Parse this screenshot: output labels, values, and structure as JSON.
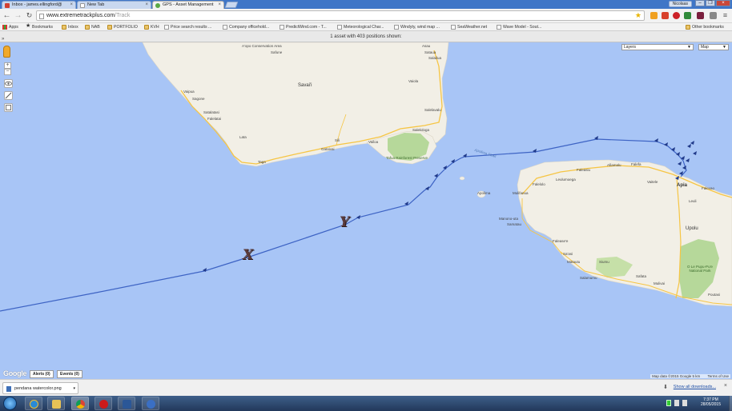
{
  "tabs": [
    {
      "label": "Inbox - james.ellingford@"
    },
    {
      "label": "New Tab"
    },
    {
      "label": "GPS - Asset Management"
    }
  ],
  "user_chip": "Nicolaas",
  "address": {
    "domain": "www.extremetrackplus.com",
    "path": "/Track"
  },
  "bookmarks": [
    {
      "label": "Apps"
    },
    {
      "label": "Bookmarks"
    },
    {
      "label": "Inbox"
    },
    {
      "label": "NAB"
    },
    {
      "label": "PORTFOLIO"
    },
    {
      "label": "KVH"
    },
    {
      "label": "Price search results ..."
    },
    {
      "label": "Company officehold..."
    },
    {
      "label": "PredictWind.com - T..."
    },
    {
      "label": "Meteorological Char..."
    },
    {
      "label": "Windyty, wind map ..."
    },
    {
      "label": "SeaWeather.net"
    },
    {
      "label": "Wave Model - Sout..."
    },
    {
      "label": "Other bookmarks"
    }
  ],
  "asset_status": "1 asset with 403 positions shown:",
  "map": {
    "layers_label": "Layers",
    "maptype_label": "Map",
    "labels": {
      "avapo": "A'opo Conservation Area",
      "safune": "Safune",
      "asau": "Asau",
      "sataua": "Sataua",
      "salailua": "Salailua",
      "vaiola": "Vaiola",
      "savaii": "Savai'i",
      "samalaeulu": "Samalaeulu",
      "vaipua": "Vaipua",
      "sagone": "Sagone",
      "satalatasi": "Satalatasi",
      "falelatai_s": "Falelatai",
      "lata": "Lata",
      "taga": "Taga",
      "salelavalu": "Salelavalu",
      "salelologa": "Salelologa",
      "sili": "Sili",
      "gataivai": "Gataivai",
      "vailoa": "Vailoa",
      "tafua": "Tafua Rainforest Preserve",
      "apolima": "Apolima Strait",
      "apia": "Apia",
      "upolu": "Upolu",
      "faleasiu": "Faleasiu",
      "leulumoega": "Leulumoega",
      "falelolo": "Falelolo",
      "mulifanua": "Mulifanua",
      "manono": "Manono-uta",
      "samatau": "Samatau",
      "falealili": "Falease'e",
      "sausi": "Sa'asi",
      "matautu": "Matautu",
      "salamumu": "Salamumu",
      "siumu": "Siumu",
      "mulivai": "Mulivai",
      "lefaga": "Lefaga",
      "safata": "Safata",
      "vaitele": "Vaitele",
      "ouapia": "Afiamalu",
      "leuli": "Leuli",
      "poutasi": "Poutasi",
      "park": "O Le Pupu-Pu'e National Park",
      "falevao": "Falevao",
      "falefa": "Falefa",
      "apolima_is": "Apolima",
      "malua": "Malua"
    },
    "google_text": "Google",
    "alerts_label": "Alerts (0)",
    "events_label": "Events (0)",
    "attribution": "Map data ©2015 Google   5 km",
    "terms": "Terms of Use",
    "annotation_x": "X",
    "annotation_y": "Y",
    "colors": {
      "sea": "#a8c5f6",
      "land": "#f2efe6",
      "park": "#b6d89a",
      "track": "#3d63c4",
      "road": "#f6c544"
    }
  },
  "downloads": {
    "file": "pendana watercolor.png",
    "show_all": "Show all downloads..."
  },
  "clock": {
    "time": "7:37 PM",
    "date": "28/05/2015"
  }
}
